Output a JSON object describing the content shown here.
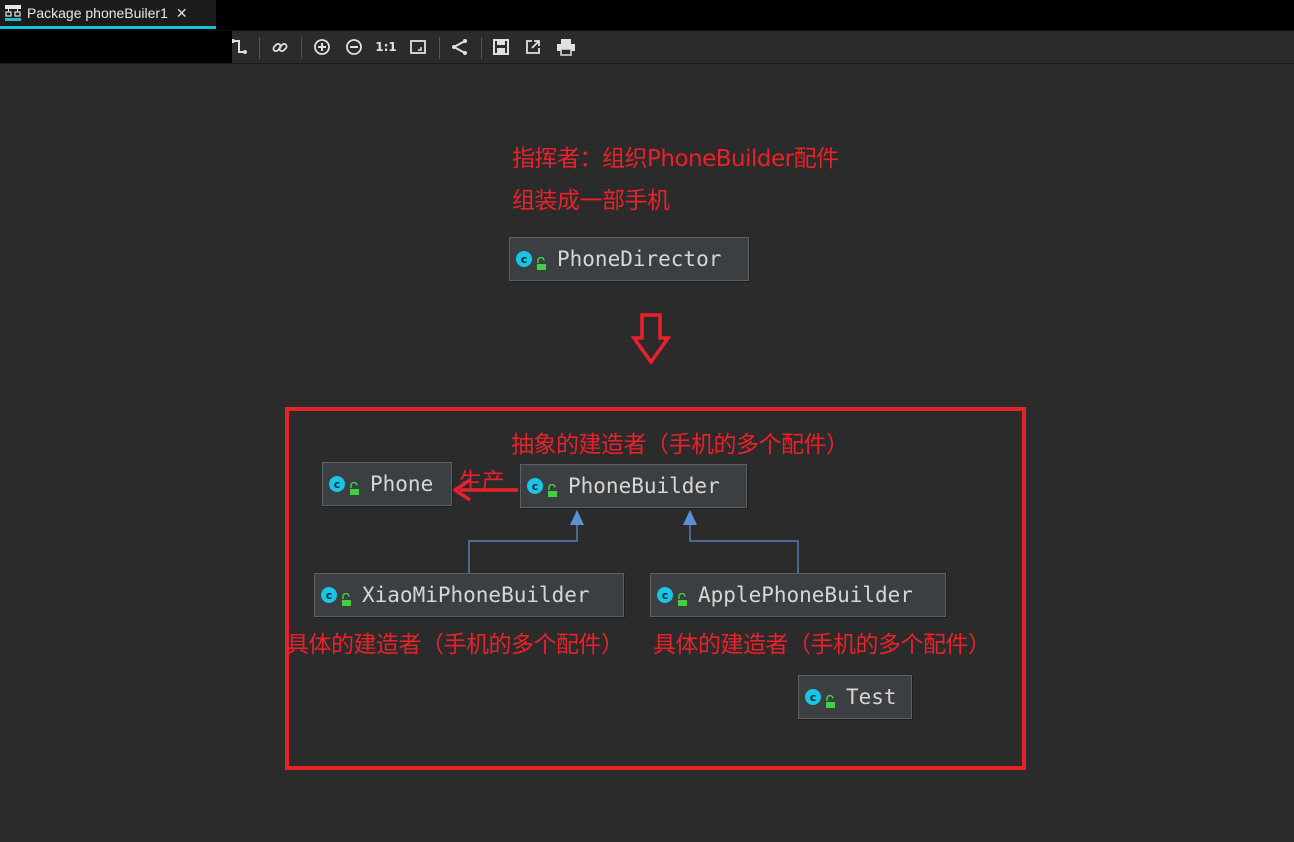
{
  "window": {
    "tab_title": "Package phoneBuiler1",
    "tab_close": "✕"
  },
  "toolbar": {
    "icons": [
      "route-icon",
      "link-icon",
      "zoom-in-icon",
      "zoom-out-icon",
      "actual-size-icon",
      "fit-content-icon",
      "layout-icon",
      "save-icon",
      "export-icon",
      "print-icon"
    ],
    "actual_size_label": "1:1"
  },
  "diagram": {
    "class_badge": "c",
    "nodes": {
      "phone_director": "PhoneDirector",
      "phone": "Phone",
      "phone_builder": "PhoneBuilder",
      "xiaomi_builder": "XiaoMiPhoneBuilder",
      "apple_builder": "ApplePhoneBuilder",
      "test": "Test"
    },
    "annotations": {
      "director_line1": "指挥者：组织PhoneBuilder配件",
      "director_line2": "组装成一部手机",
      "abstract_builder": "抽象的建造者（手机的多个配件）",
      "produce": "生产",
      "xiaomi_desc": "具体的建造者（手机的多个配件）",
      "apple_desc": "具体的建造者（手机的多个配件）"
    },
    "colors": {
      "annotation": "#e8222b",
      "class_icon": "#19c5e6",
      "inheritance_edge": "#5b8fd6"
    }
  }
}
